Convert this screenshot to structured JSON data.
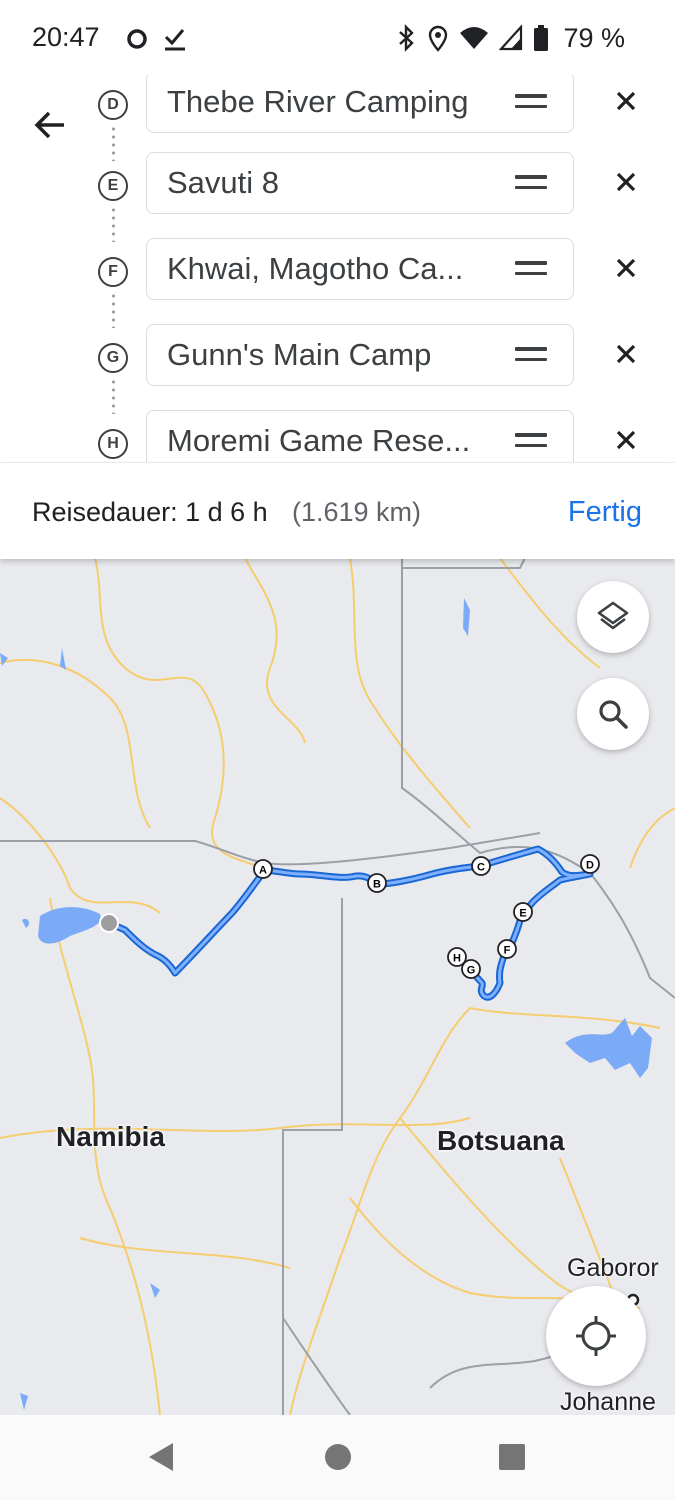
{
  "status_bar": {
    "time": "20:47",
    "battery": "79 %",
    "icons": [
      "circle-notification-icon",
      "check-download-icon",
      "bluetooth-icon",
      "location-icon",
      "wifi-icon",
      "cell-signal-icon",
      "battery-icon"
    ]
  },
  "route_editor": {
    "back_icon": "arrow-back-icon",
    "stops": [
      {
        "letter": "D",
        "name": "Thebe River Camping"
      },
      {
        "letter": "E",
        "name": "Savuti 8"
      },
      {
        "letter": "F",
        "name": "Khwai, Magotho Ca..."
      },
      {
        "letter": "G",
        "name": "Gunn's Main Camp"
      },
      {
        "letter": "H",
        "name": "Moremi Game Rese..."
      }
    ]
  },
  "summary": {
    "duration_label": "Reisedauer: 1 d 6 h",
    "distance": "(1.619 km)",
    "done_label": "Fertig"
  },
  "map": {
    "country_labels": [
      "Namibia",
      "Botsuana"
    ],
    "city_labels": [
      "Gaboror",
      "Johanne"
    ],
    "waypoint_letters": [
      "A",
      "B",
      "C",
      "D",
      "E",
      "F",
      "G",
      "H"
    ],
    "colors": {
      "route": "#4285f4",
      "route_outline": "#1967d2",
      "water": "#7baaf7",
      "roads": "#f5cd6e",
      "borders": "#9aa0a6"
    }
  }
}
